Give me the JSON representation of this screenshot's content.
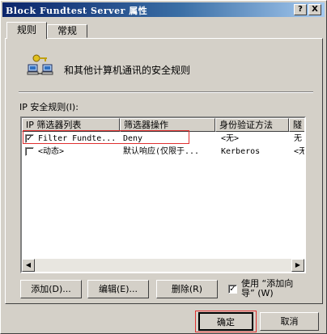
{
  "window": {
    "title": "Block Fundtest Server 属性",
    "help_label": "?",
    "close_label": "X"
  },
  "tabs": [
    {
      "label": "规则",
      "selected": true
    },
    {
      "label": "常规",
      "selected": false
    }
  ],
  "description": "和其他计算机通讯的安全规则",
  "rules_label": "IP 安全规则(I):",
  "table": {
    "columns": [
      "IP 筛选器列表",
      "筛选器操作",
      "身份验证方法",
      "隧"
    ],
    "rows": [
      {
        "checked": true,
        "check_glyph": "✓",
        "filter": "Filter Fundte...",
        "action": "Deny",
        "auth": "<无>",
        "tunnel": "无"
      },
      {
        "checked": false,
        "check_glyph": "",
        "filter": "<动态>",
        "action": "默认响应(仅限于...",
        "auth": "Kerberos",
        "tunnel": "<无"
      }
    ]
  },
  "scroll": {
    "left_arrow": "◀",
    "right_arrow": "▶"
  },
  "buttons": {
    "add": "添加(D)...",
    "edit": "编辑(E)...",
    "remove": "删除(R)",
    "ok": "确定",
    "cancel": "取消"
  },
  "wizard": {
    "checked": true,
    "check_glyph": "✓",
    "label_line1": "使用 “添加向",
    "label_line2": "导” (W)"
  },
  "colors": {
    "highlight_box": "#e03030",
    "titlebar_start": "#0a246a",
    "face": "#d4d0c8"
  }
}
